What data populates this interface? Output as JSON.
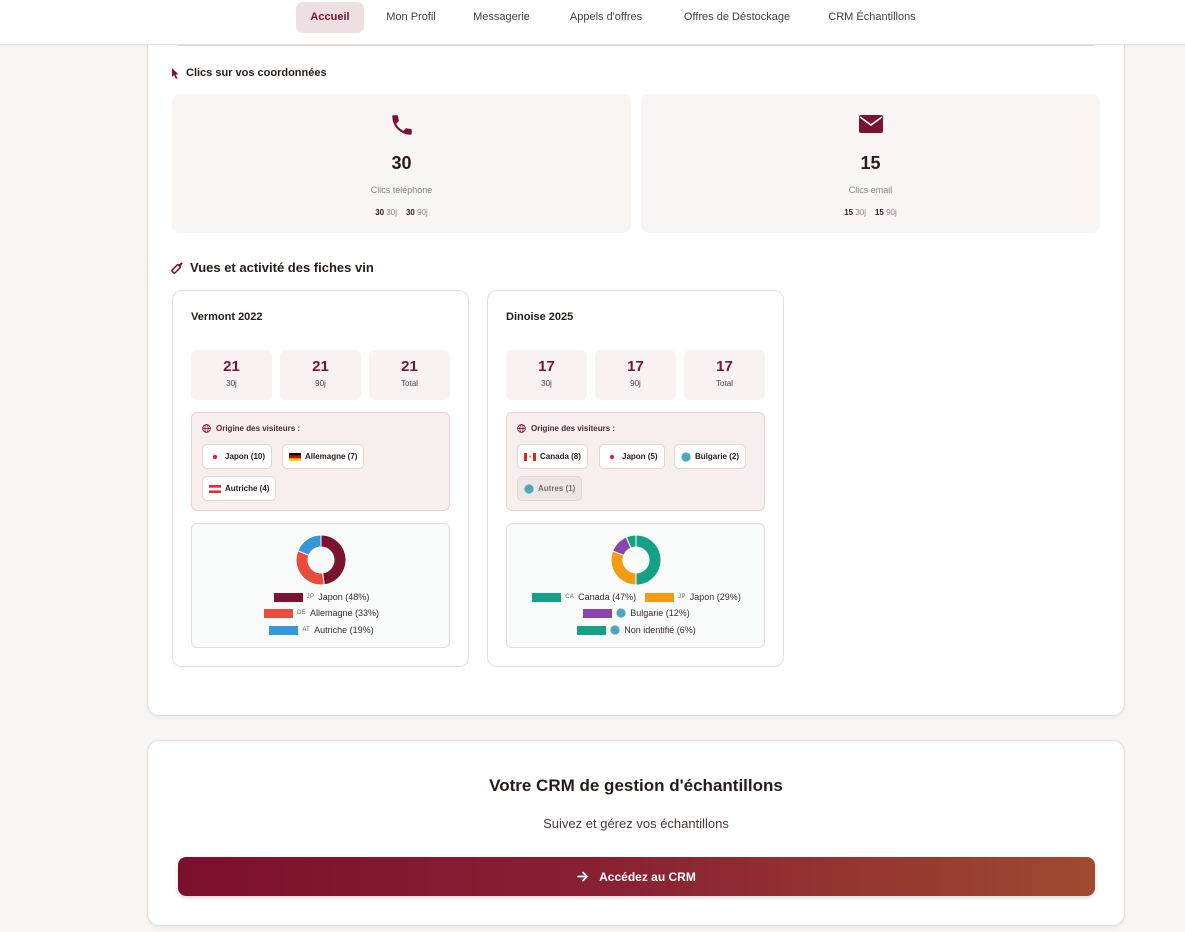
{
  "nav": {
    "tabs": [
      {
        "label": "Accueil",
        "active": true
      },
      {
        "label": "Mon Profil"
      },
      {
        "label": "Messagerie"
      },
      {
        "label": "Appels d'offres"
      },
      {
        "label": "Offres de Déstockage"
      },
      {
        "label": "CRM Échantillons"
      }
    ]
  },
  "clicks": {
    "title": "Clics sur vos coordonnées",
    "icon": "cursor-icon",
    "phone": {
      "icon": "phone-icon",
      "value": "30",
      "label": "Clics téléphone",
      "d30": "30",
      "d30_unit": "30j",
      "d90": "30",
      "d90_unit": "90j"
    },
    "email": {
      "icon": "envelope-icon",
      "value": "15",
      "label": "Clics email",
      "d30": "15",
      "d30_unit": "30j",
      "d90": "15",
      "d90_unit": "90j"
    }
  },
  "wines": {
    "title": "Vues et activité des fiches vin",
    "icon": "wine-bottle-icon",
    "origin_title": "Origine des visiteurs :",
    "items": [
      {
        "name": "Vermont 2022",
        "stats": [
          {
            "value": "21",
            "label": "30j"
          },
          {
            "value": "21",
            "label": "90j"
          },
          {
            "value": "21",
            "label": "Total"
          }
        ],
        "chips": [
          {
            "flag": "jp",
            "text": "Japon (10)"
          },
          {
            "flag": "de",
            "text": "Allemagne (7)"
          },
          {
            "flag": "at",
            "text": "Autriche (4)"
          }
        ],
        "legend": [
          {
            "code": "JP",
            "text": "Japon (48%)",
            "color": "#7b1230"
          },
          {
            "code": "DE",
            "text": "Allemagne (33%)",
            "color": "#e74c3c"
          },
          {
            "code": "AT",
            "text": "Autriche (19%)",
            "color": "#3498db"
          }
        ]
      },
      {
        "name": "Dinoise 2025",
        "stats": [
          {
            "value": "17",
            "label": "30j"
          },
          {
            "value": "17",
            "label": "90j"
          },
          {
            "value": "17",
            "label": "Total"
          }
        ],
        "chips": [
          {
            "flag": "ca",
            "text": "Canada (8)"
          },
          {
            "flag": "jp",
            "text": "Japon (5)"
          },
          {
            "flag": "globe",
            "text": "Bulgarie (2)"
          },
          {
            "flag": "globe",
            "text": "Autres (1)",
            "muted": true
          }
        ],
        "legend": [
          {
            "code": "CA",
            "text": "Canada (47%)",
            "color": "#16a085"
          },
          {
            "code": "JP",
            "text": "Japon (29%)",
            "color": "#f39c12"
          },
          {
            "code": "",
            "globe": true,
            "text": "Bulgarie (12%)",
            "color": "#8e44ad"
          },
          {
            "code": "",
            "globe": true,
            "text": "Non identifié (6%)",
            "color": "#16a085"
          }
        ]
      }
    ]
  },
  "crm": {
    "title": "Votre CRM de gestion d'échantillons",
    "subtitle": "Suivez et gérez vos échantillons",
    "button_label": "Accédez au CRM",
    "button_icon": "arrow-right-icon"
  },
  "chart_data": [
    {
      "type": "pie",
      "title": "",
      "categories": [
        "Japon",
        "Allemagne",
        "Autriche"
      ],
      "values": [
        48,
        33,
        19
      ],
      "colors": [
        "#7b1230",
        "#e74c3c",
        "#3498db"
      ],
      "legend": "bottom"
    },
    {
      "type": "pie",
      "title": "",
      "categories": [
        "Canada",
        "Japon",
        "Bulgarie",
        "Non identifié"
      ],
      "values": [
        47,
        29,
        12,
        6
      ],
      "colors": [
        "#16a085",
        "#f39c12",
        "#8e44ad",
        "#16a085"
      ],
      "legend": "bottom"
    }
  ]
}
